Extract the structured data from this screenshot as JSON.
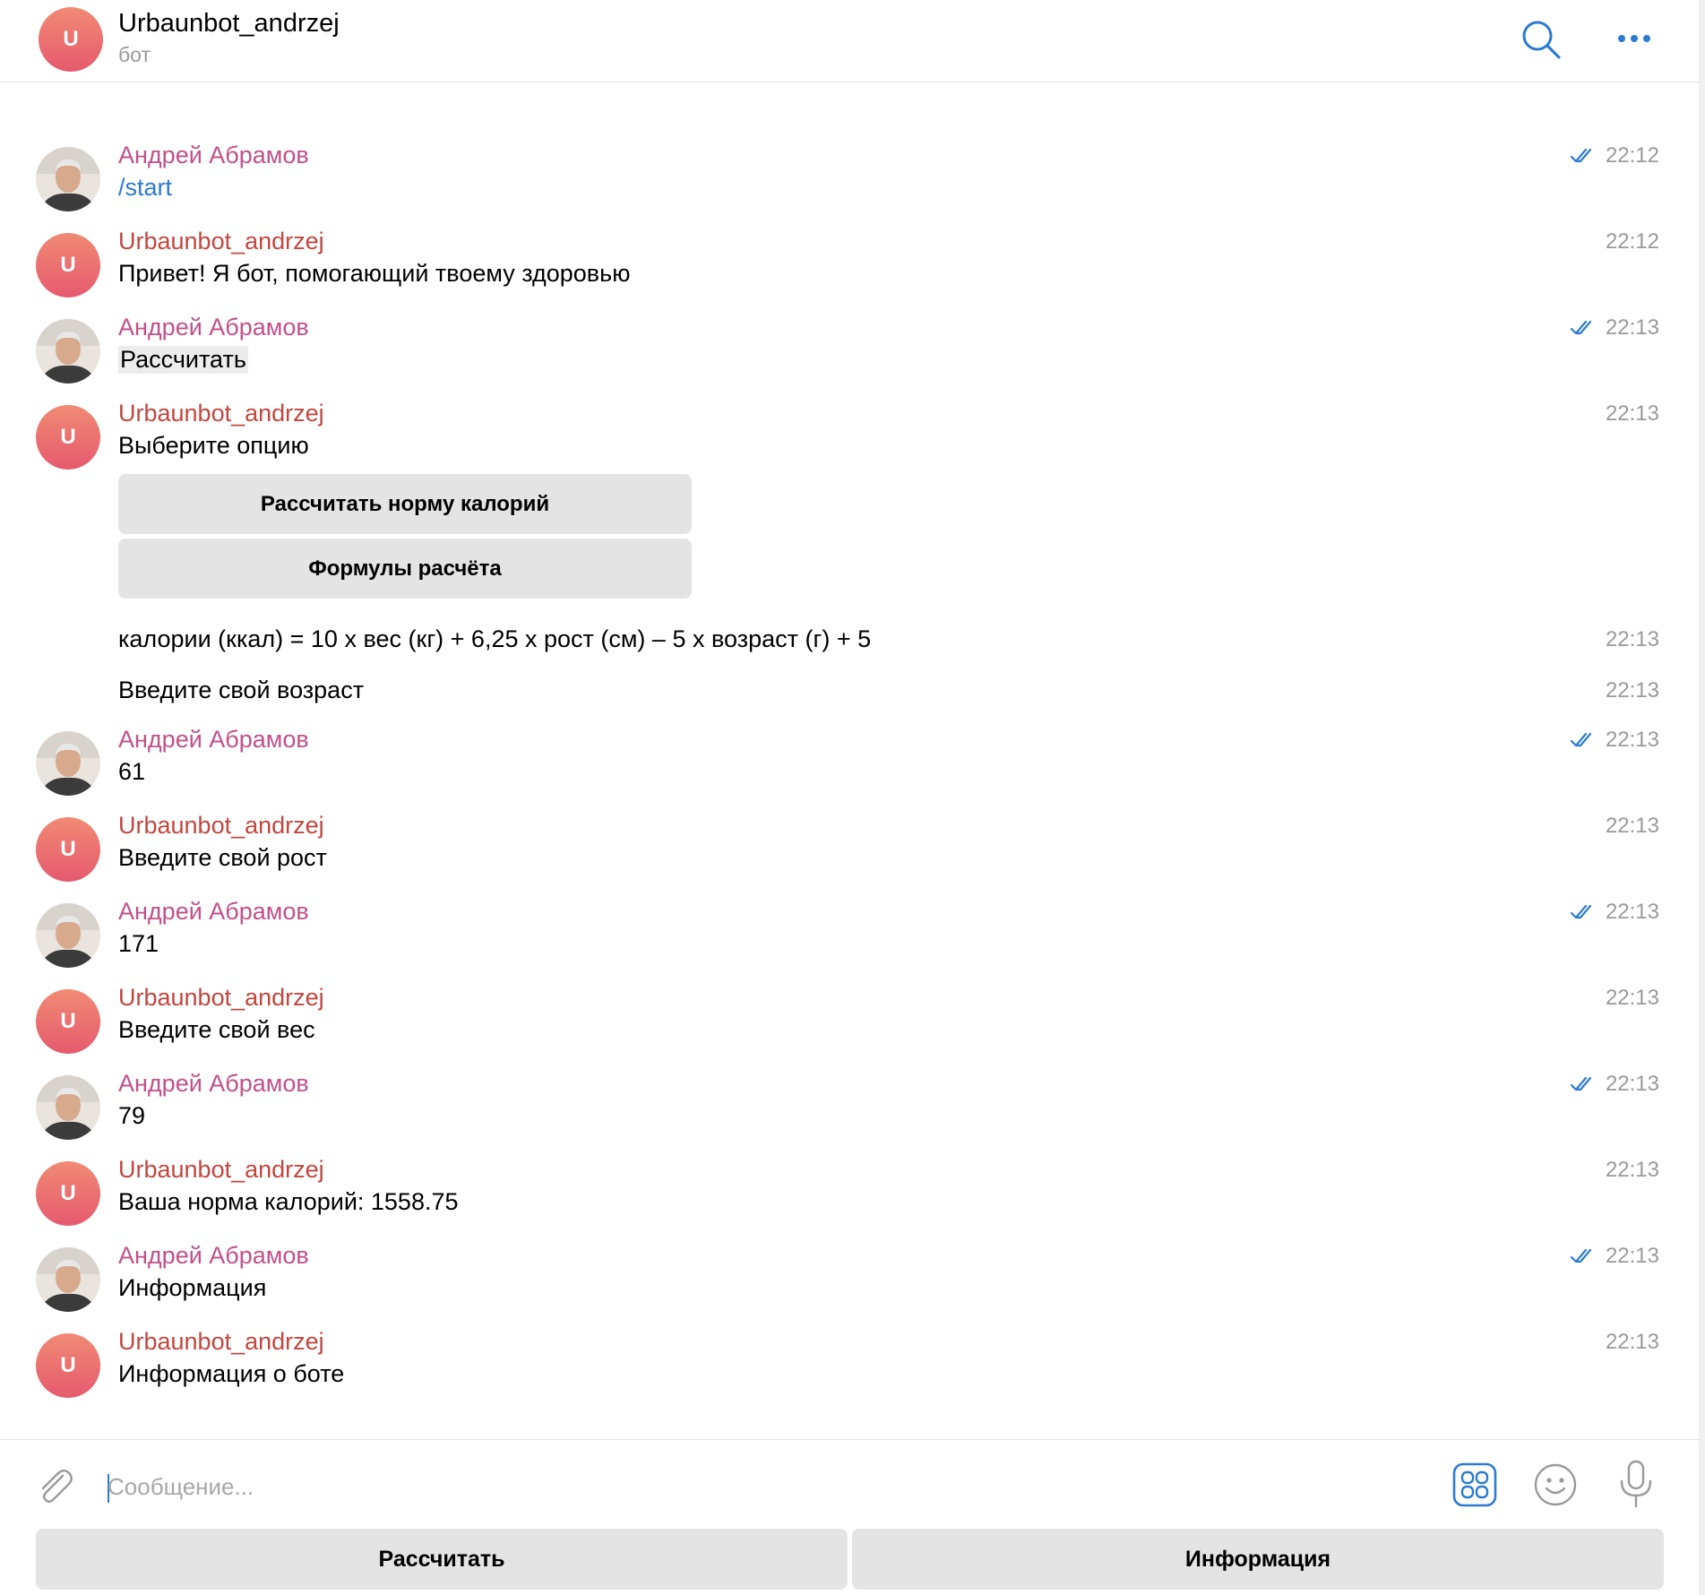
{
  "header": {
    "title": "Urbaunbot_andrzej",
    "subtitle": "бот",
    "avatar_letter": "U"
  },
  "messages": [
    {
      "sender": "Андрей Абрамов",
      "text": "/start",
      "time": "22:12"
    },
    {
      "sender": "Urbaunbot_andrzej",
      "text": "Привет! Я бот, помогающий твоему здоровью",
      "time": "22:12"
    },
    {
      "sender": "Андрей Абрамов",
      "text": "Рассчитать",
      "time": "22:13"
    },
    {
      "sender": "Urbaunbot_andrzej",
      "text": "Выберите опцию",
      "time": "22:13",
      "buttons": [
        "Рассчитать норму калорий",
        "Формулы расчёта"
      ]
    },
    {
      "text": "калории (ккал) = 10 x вес (кг) + 6,25 x рост (см) – 5 x возраст (г) + 5",
      "time": "22:13"
    },
    {
      "text": "Введите свой возраст",
      "time": "22:13"
    },
    {
      "sender": "Андрей Абрамов",
      "text": "61",
      "time": "22:13"
    },
    {
      "sender": "Urbaunbot_andrzej",
      "text": "Введите свой рост",
      "time": "22:13"
    },
    {
      "sender": "Андрей Абрамов",
      "text": "171",
      "time": "22:13"
    },
    {
      "sender": "Urbaunbot_andrzej",
      "text": "Введите свой вес",
      "time": "22:13"
    },
    {
      "sender": "Андрей Абрамов",
      "text": "79",
      "time": "22:13"
    },
    {
      "sender": "Urbaunbot_andrzej",
      "text": "Ваша норма калорий: 1558.75",
      "time": "22:13"
    },
    {
      "sender": "Андрей Абрамов",
      "text": "Информация",
      "time": "22:13"
    },
    {
      "sender": "Urbaunbot_andrzej",
      "text": "Информация о боте",
      "time": "22:13"
    }
  ],
  "composer": {
    "placeholder": "Сообщение..."
  },
  "keyboard": [
    "Рассчитать",
    "Информация"
  ],
  "colors": {
    "accent": "#2a7bd1",
    "user_name": "#c2508b",
    "bot_name": "#c4463f",
    "button_bg": "#e4e4e4",
    "timestamp": "#9a9a9a"
  }
}
